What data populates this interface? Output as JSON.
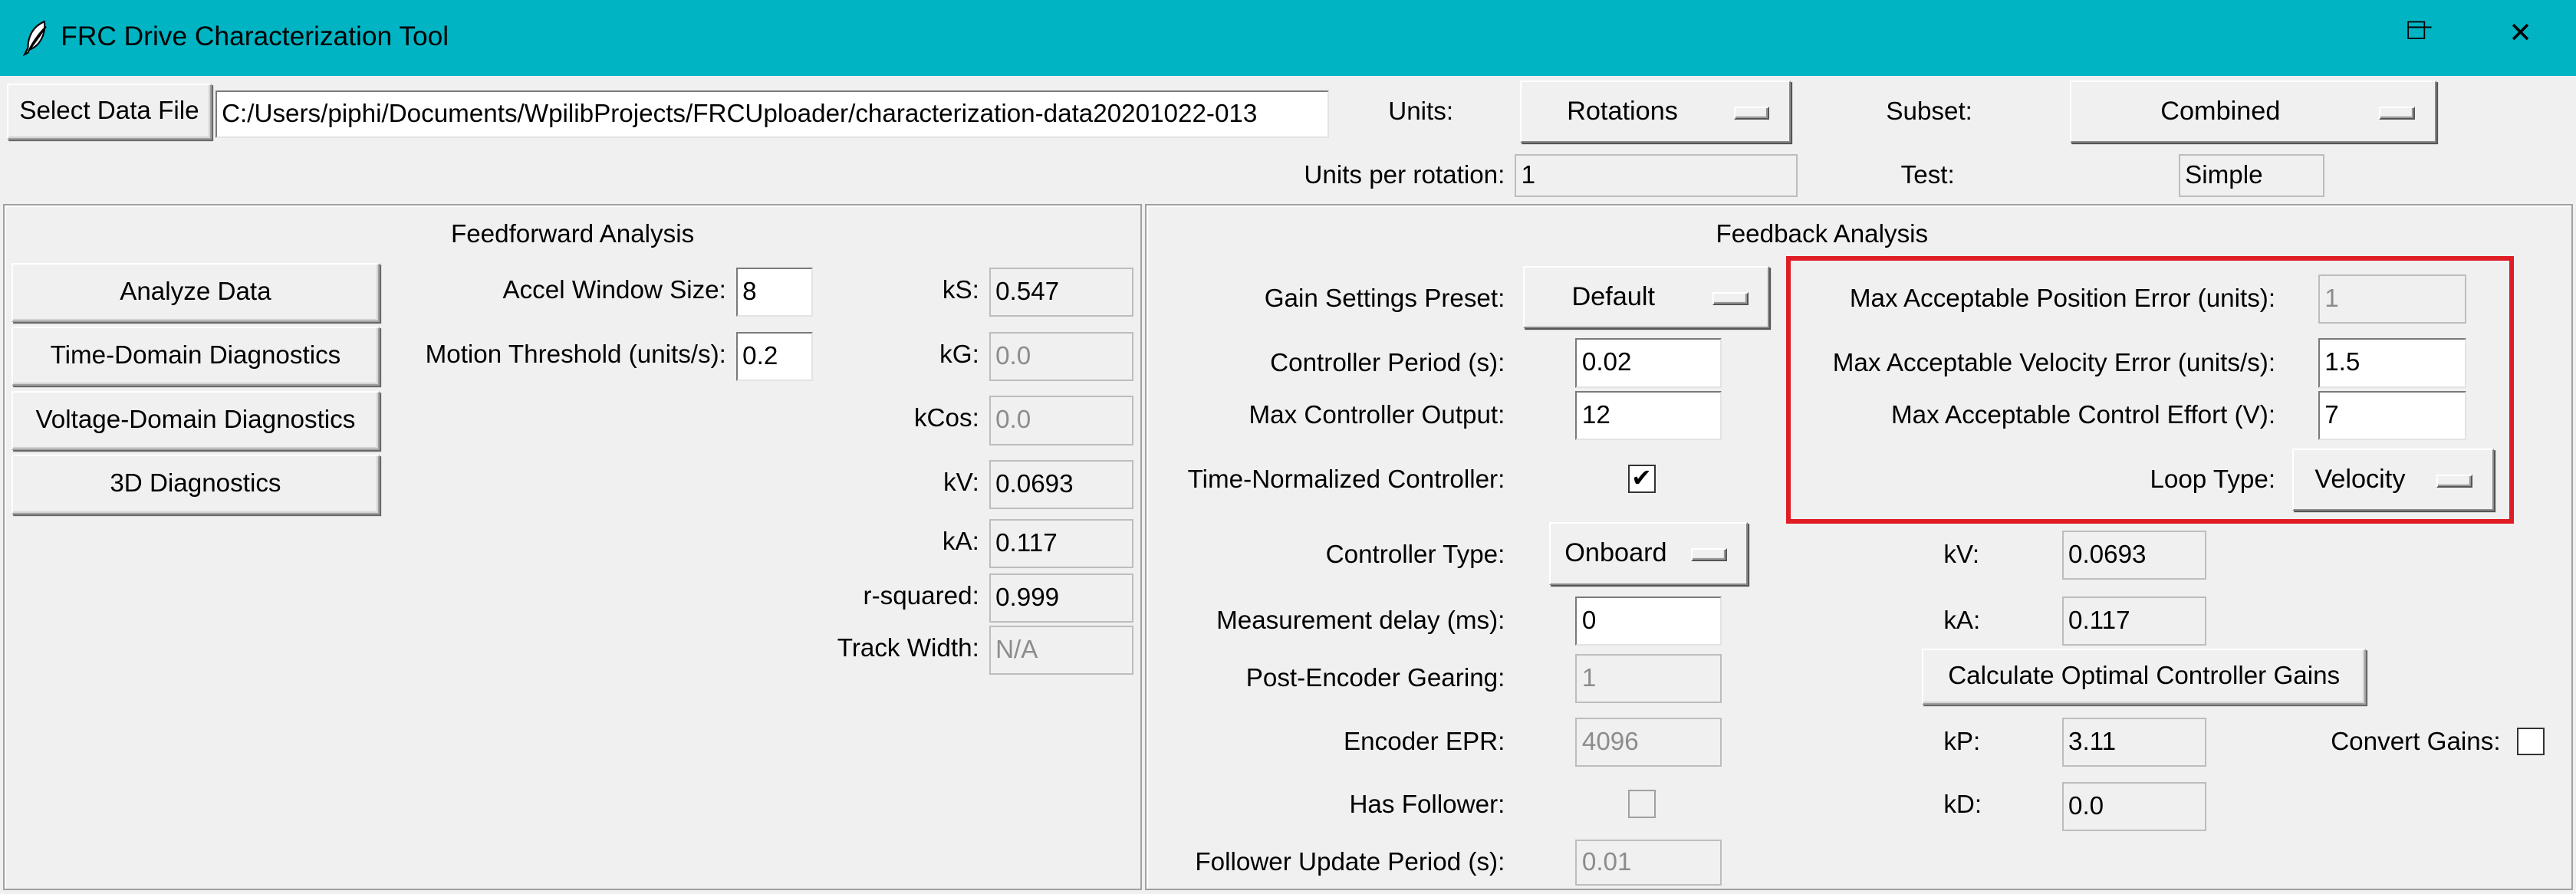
{
  "window": {
    "title": "FRC Drive Characterization Tool",
    "minimize_glyph": "—",
    "maximize_glyph": "☐",
    "close_glyph": "✕"
  },
  "top": {
    "select_file_label": "Select Data File",
    "file_path": "C:/Users/piphi/Documents/WpilibProjects/FRCUploader/characterization-data20201022-013",
    "units_label": "Units:",
    "units_value": "Rotations",
    "subset_label": "Subset:",
    "subset_value": "Combined",
    "units_per_rotation_label": "Units per rotation:",
    "units_per_rotation_value": "1",
    "test_label": "Test:",
    "test_value": "Simple"
  },
  "ff": {
    "title": "Feedforward Analysis",
    "buttons": {
      "analyze": "Analyze Data",
      "time_diag": "Time-Domain Diagnostics",
      "voltage_diag": "Voltage-Domain Diagnostics",
      "diag3d": "3D Diagnostics"
    },
    "accel_window_label": "Accel Window Size:",
    "accel_window_value": "8",
    "motion_threshold_label": "Motion Threshold (units/s):",
    "motion_threshold_value": "0.2",
    "ks_label": "kS:",
    "ks_value": "0.547",
    "kg_label": "kG:",
    "kg_value": "0.0",
    "kcos_label": "kCos:",
    "kcos_value": "0.0",
    "kv_label": "kV:",
    "kv_value": "0.0693",
    "ka_label": "kA:",
    "ka_value": "0.117",
    "rsq_label": "r-squared:",
    "rsq_value": "0.999",
    "track_width_label": "Track Width:",
    "track_width_value": "N/A"
  },
  "fb": {
    "title": "Feedback Analysis",
    "gain_preset_label": "Gain Settings Preset:",
    "gain_preset_value": "Default",
    "controller_period_label": "Controller Period (s):",
    "controller_period_value": "0.02",
    "max_output_label": "Max Controller Output:",
    "max_output_value": "12",
    "time_normalized_label": "Time-Normalized Controller:",
    "time_normalized_checked": true,
    "controller_type_label": "Controller Type:",
    "controller_type_value": "Onboard",
    "measurement_delay_label": "Measurement delay (ms):",
    "measurement_delay_value": "0",
    "post_encoder_label": "Post-Encoder Gearing:",
    "post_encoder_value": "1",
    "encoder_epr_label": "Encoder EPR:",
    "encoder_epr_value": "4096",
    "has_follower_label": "Has Follower:",
    "has_follower_checked": false,
    "follower_period_label": "Follower Update Period (s):",
    "follower_period_value": "0.01",
    "max_pos_err_label": "Max Acceptable Position Error (units):",
    "max_pos_err_value": "1",
    "max_vel_err_label": "Max Acceptable Velocity Error (units/s):",
    "max_vel_err_value": "1.5",
    "max_effort_label": "Max Acceptable Control Effort (V):",
    "max_effort_value": "7",
    "loop_type_label": "Loop Type:",
    "loop_type_value": "Velocity",
    "kv_label": "kV:",
    "kv_value": "0.0693",
    "ka_label": "kA:",
    "ka_value": "0.117",
    "calc_button": "Calculate Optimal Controller Gains",
    "kp_label": "kP:",
    "kp_value": "3.11",
    "kd_label": "kD:",
    "kd_value": "0.0",
    "convert_gains_label": "Convert Gains:",
    "convert_gains_checked": false,
    "check_glyph": "✔"
  },
  "colors": {
    "titlebar": "#00b4c4",
    "highlight": "#e01c25"
  }
}
